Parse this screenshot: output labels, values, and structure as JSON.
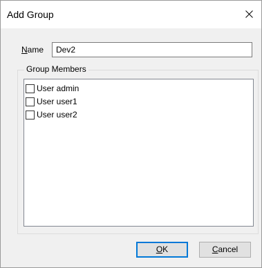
{
  "window": {
    "title": "Add Group",
    "close_icon": "close-icon"
  },
  "name_field": {
    "label_accel": "N",
    "label_rest": "ame",
    "value": "Dev2"
  },
  "group_members": {
    "label": "Group Members",
    "items": [
      {
        "label": "User admin",
        "checked": false
      },
      {
        "label": "User user1",
        "checked": false
      },
      {
        "label": "User user2",
        "checked": false
      }
    ]
  },
  "buttons": {
    "ok_accel": "O",
    "ok_rest": "K",
    "cancel_accel": "C",
    "cancel_rest": "ancel"
  }
}
